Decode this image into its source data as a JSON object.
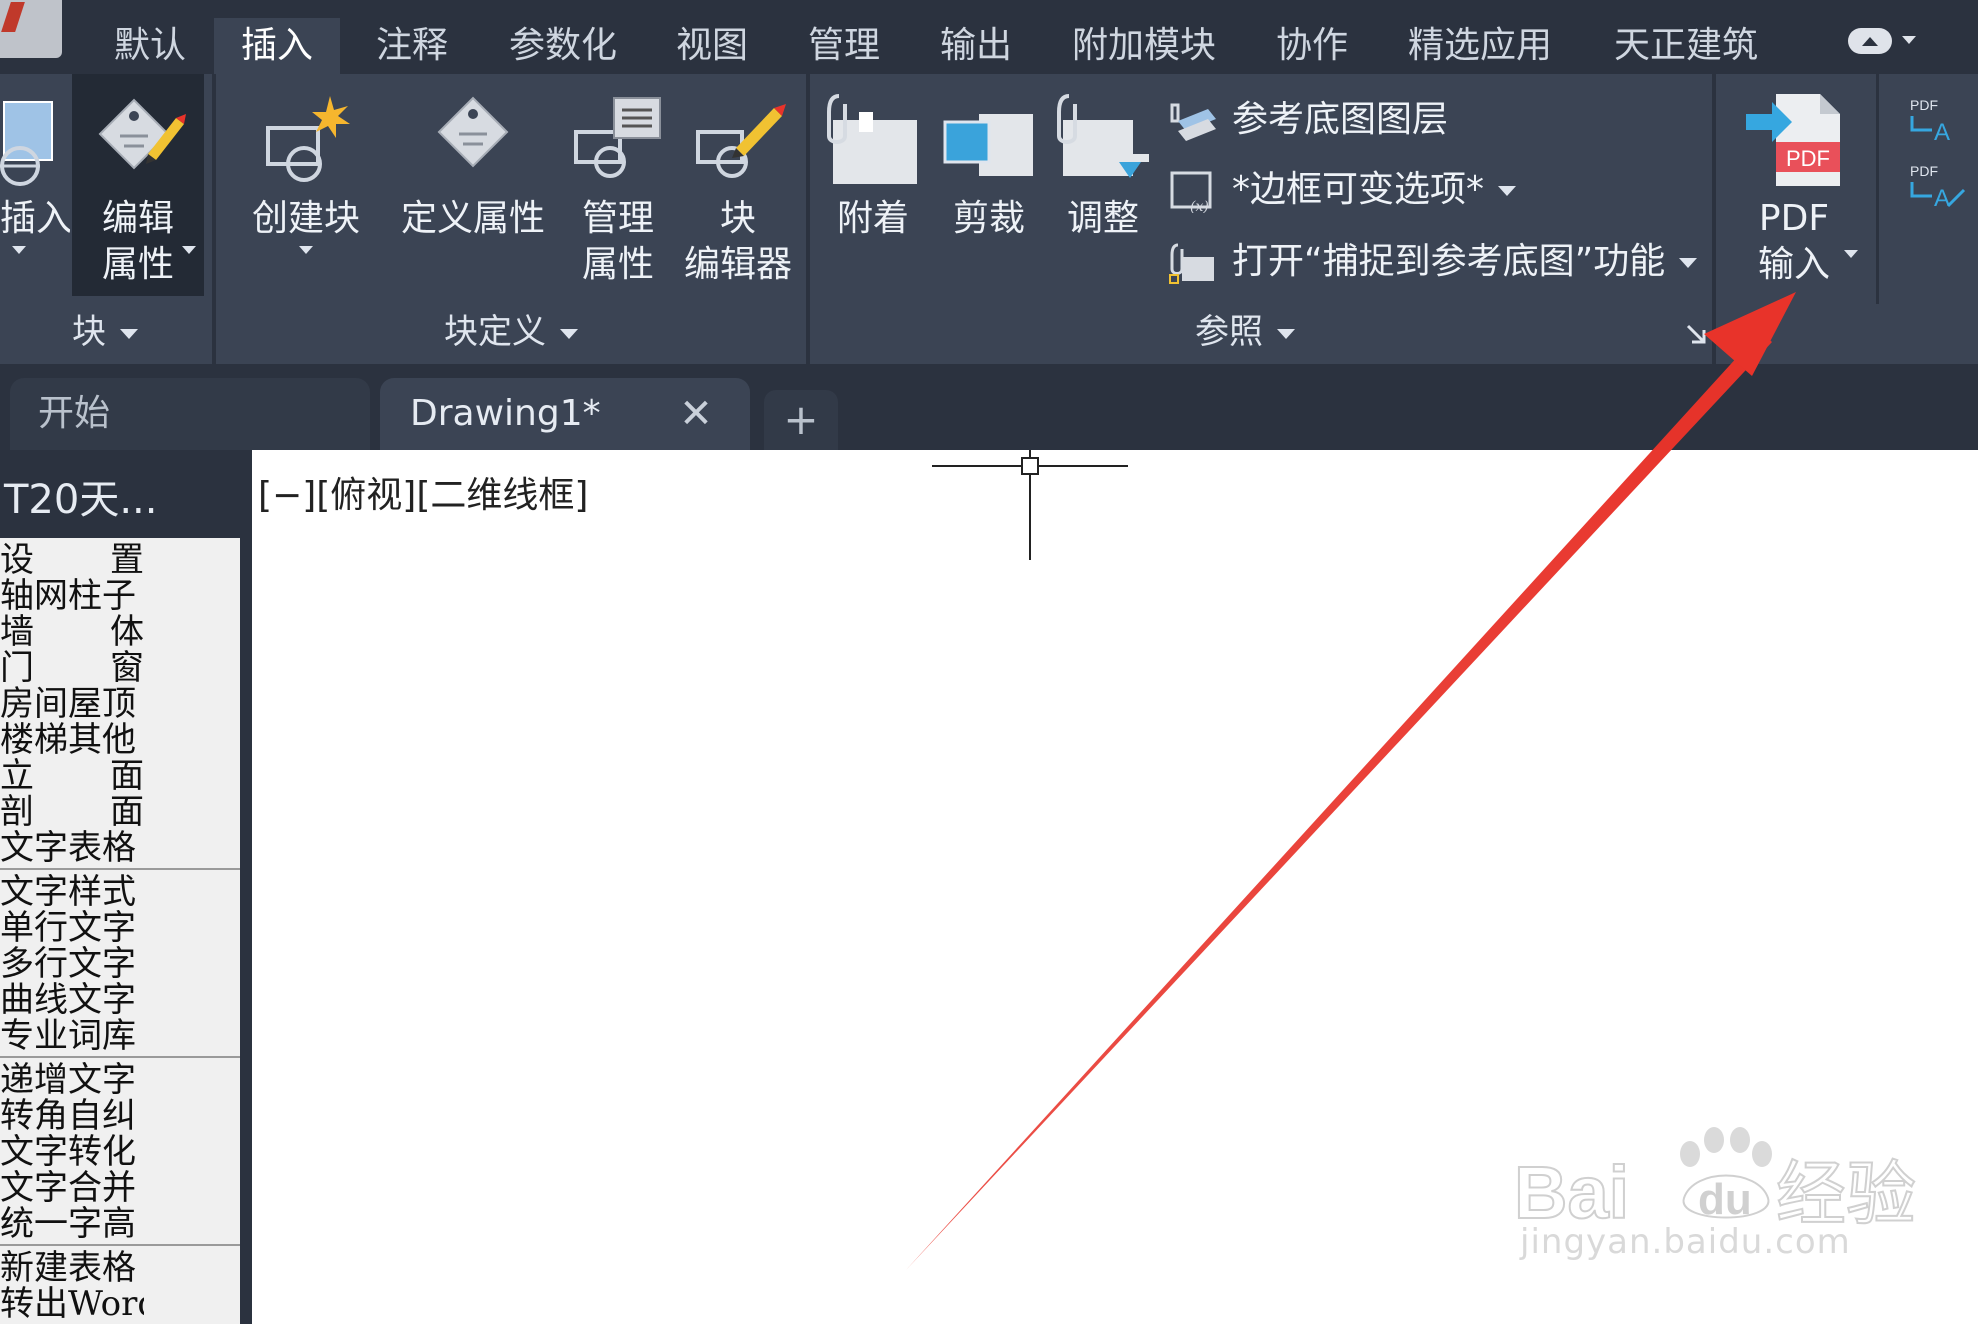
{
  "menu": {
    "tabs": [
      {
        "label": "默认"
      },
      {
        "label": "插入",
        "active": true
      },
      {
        "label": "注释"
      },
      {
        "label": "参数化"
      },
      {
        "label": "视图"
      },
      {
        "label": "管理"
      },
      {
        "label": "输出"
      },
      {
        "label": "附加模块"
      },
      {
        "label": "协作"
      },
      {
        "label": "精选应用"
      },
      {
        "label": "天正建筑"
      }
    ]
  },
  "ribbon": {
    "block_panel": {
      "insert_label": "插入",
      "edit_attr_line1": "编辑",
      "edit_attr_line2": "属性",
      "footer": "块"
    },
    "block_def_panel": {
      "create_block": "创建块",
      "define_attr": "定义属性",
      "manage_attr_line1": "管理",
      "manage_attr_line2": "属性",
      "block_editor_line1": "块",
      "block_editor_line2": "编辑器",
      "footer": "块定义"
    },
    "reference_panel": {
      "attach": "附着",
      "clip": "剪裁",
      "adjust": "调整",
      "underlay_layers": "参考底图图层",
      "frame_option": "*边框可变选项*",
      "snap_underlay": "打开“捕捉到参考底图”功能",
      "footer": "参照"
    },
    "import_panel": {
      "pdf_icon_text": "PDF",
      "pdf_import_line1": "PDF",
      "pdf_import_line2": "输入",
      "small_pdf_label": "PDF"
    }
  },
  "doc_tabs": {
    "start": "开始",
    "drawing": "Drawing1*",
    "close": "✕",
    "add": "+"
  },
  "left_panel": {
    "title": "T20天...",
    "items": [
      {
        "a": "设",
        "b": "置"
      },
      {
        "text": "轴网柱子"
      },
      {
        "a": "墙",
        "b": "体"
      },
      {
        "a": "门",
        "b": "窗"
      },
      {
        "text": "房间屋顶"
      },
      {
        "text": "楼梯其他"
      },
      {
        "a": "立",
        "b": "面"
      },
      {
        "a": "剖",
        "b": "面"
      },
      {
        "text": "文字表格"
      },
      {
        "text": "文字样式"
      },
      {
        "text": "单行文字"
      },
      {
        "text": "多行文字"
      },
      {
        "text": "曲线文字"
      },
      {
        "text": "专业词库"
      },
      {
        "text": "递增文字"
      },
      {
        "text": "转角自纠"
      },
      {
        "text": "文字转化"
      },
      {
        "text": "文字合并"
      },
      {
        "text": "统一字高"
      },
      {
        "text": "新建表格"
      },
      {
        "text": "转出Word"
      }
    ]
  },
  "canvas": {
    "viewport_label": "[−][俯视][二维线框]"
  },
  "watermark": {
    "brand": "Bai",
    "brand2": "du",
    "cn": "经验",
    "url": "jingyan.baidu.com"
  },
  "colors": {
    "ribbon_bg": "#3b4454",
    "menubar_bg": "#2b323f",
    "annotation_arrow": "#e8332a",
    "pdf_red": "#e9505a",
    "import_blue": "#36a7e0"
  }
}
